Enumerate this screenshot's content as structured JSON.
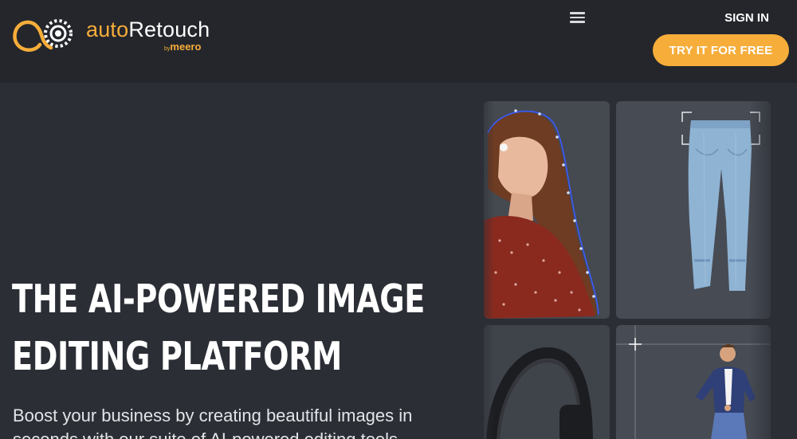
{
  "header": {
    "logo": {
      "brand_part1": "auto",
      "brand_part2": "Retouch",
      "by": "by",
      "company": "meero"
    },
    "menu_icon": "hamburger-icon",
    "signin_label": "SIGN IN",
    "cta_label": "TRY IT FOR FREE"
  },
  "hero": {
    "headline_line1": "THE AI-POWERED IMAGE",
    "headline_line2": "EDITING PLATFORM",
    "subtext": "Boost your business by creating beautiful images in seconds with our suite of AI-powered editing tools"
  },
  "showcase": {
    "tiles": [
      {
        "subject": "woman-portrait-image"
      },
      {
        "subject": "jeans-image"
      },
      {
        "subject": "headphones-image"
      },
      {
        "subject": "man-jumping-image"
      }
    ]
  },
  "colors": {
    "accent": "#f6ad3a",
    "header_bg": "#24262b",
    "page_bg": "#2b2e35",
    "tile_bg": "#474b53",
    "outline_blue": "#3b5bff"
  }
}
